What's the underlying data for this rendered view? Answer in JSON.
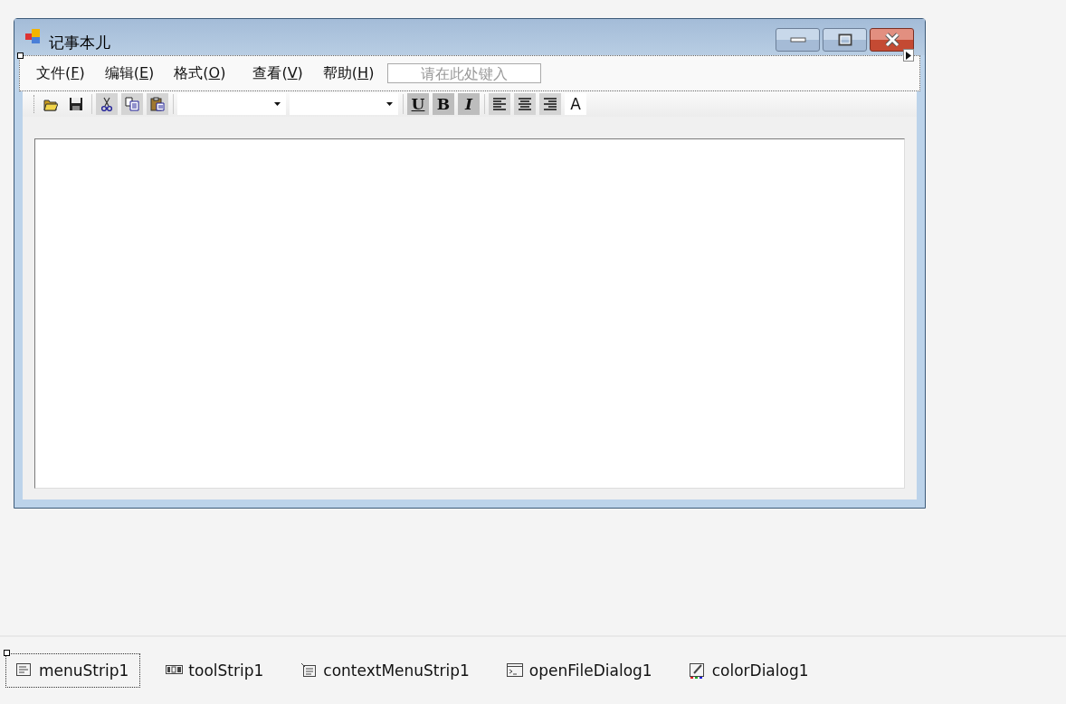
{
  "window": {
    "title": "记事本儿"
  },
  "menu": {
    "items": [
      {
        "label": "文件(F)"
      },
      {
        "label": "编辑(E)"
      },
      {
        "label": "格式(O)"
      },
      {
        "label": "查看(V)"
      },
      {
        "label": "帮助(H)"
      }
    ],
    "type_here": {
      "placeholder": "请在此处键入"
    }
  },
  "toolbar": [
    {
      "kind": "folder"
    },
    {
      "kind": "save"
    },
    {
      "kind": "separator"
    },
    {
      "kind": "cut"
    },
    {
      "kind": "copy"
    },
    {
      "kind": "paste"
    },
    {
      "kind": "separator"
    },
    {
      "kind": "combo"
    },
    {
      "kind": "combo"
    },
    {
      "kind": "separator"
    },
    {
      "kind": "underline",
      "text": "U"
    },
    {
      "kind": "bold",
      "text": "B"
    },
    {
      "kind": "italic",
      "text": "I"
    },
    {
      "kind": "separator"
    },
    {
      "kind": "align-left"
    },
    {
      "kind": "align-center"
    },
    {
      "kind": "align-right"
    },
    {
      "kind": "font",
      "text": "A"
    }
  ],
  "tray": [
    {
      "label": "menuStrip1",
      "selected": true
    },
    {
      "label": "toolStrip1",
      "selected": false
    },
    {
      "label": "contextMenuStrip1",
      "selected": false
    },
    {
      "label": "openFileDialog1",
      "selected": false
    },
    {
      "label": "colorDialog1",
      "selected": false
    }
  ]
}
